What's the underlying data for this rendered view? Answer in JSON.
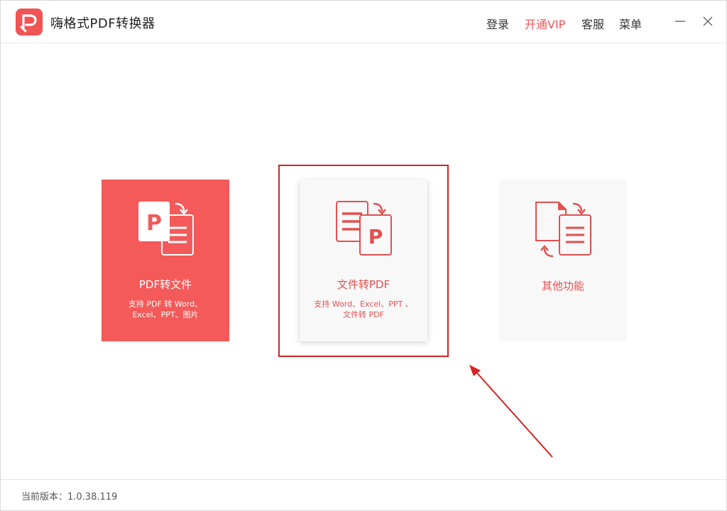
{
  "app": {
    "title": "嗨格式PDF转换器",
    "logo_icon": "pdf-logo-icon"
  },
  "header": {
    "login_label": "登录",
    "vip_label": "开通VIP",
    "service_label": "客服",
    "menu_label": "菜单"
  },
  "cards": {
    "pdf_to_file": {
      "title": "PDF转文件",
      "desc_line1": "支持 PDF 转 Word、",
      "desc_line2": "Excel、PPT、图片"
    },
    "file_to_pdf": {
      "title": "文件转PDF",
      "desc_line1": "支持 Word、Excel、PPT 、",
      "desc_line2": "文件转 PDF"
    },
    "other": {
      "title": "其他功能"
    }
  },
  "footer": {
    "version_text": "当前版本：1.0.38.119"
  },
  "colors": {
    "accent": "#f05454",
    "annotation": "#d42323"
  }
}
